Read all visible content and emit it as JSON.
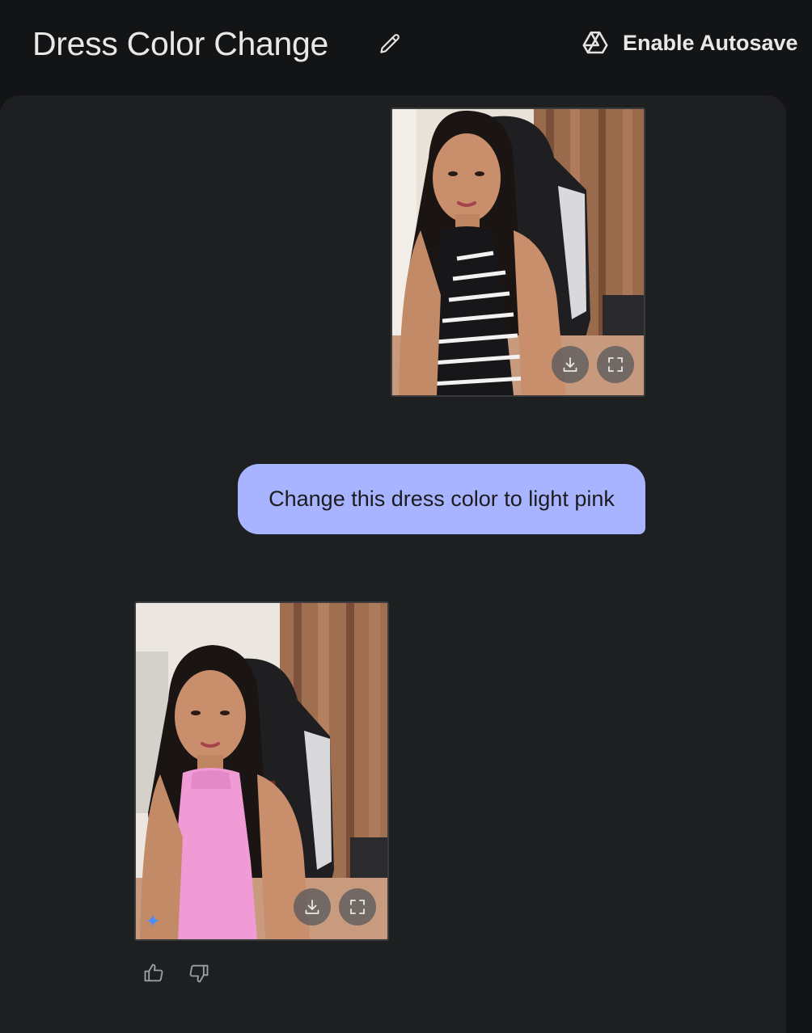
{
  "header": {
    "title": "Dress Color Change",
    "autosave_label": "Enable Autosave"
  },
  "conversation": {
    "user_message": "Change this dress color to light pink"
  },
  "icons": {
    "edit": "pencil-icon",
    "autosave": "google-drive-icon",
    "download": "download-icon",
    "fullscreen": "fullscreen-icon",
    "spark": "gemini-spark-icon",
    "like": "thumbs-up-icon",
    "dislike": "thumbs-down-icon"
  },
  "colors": {
    "background": "#131416",
    "panel": "#1e1f20",
    "bubble": "#a8b4ff",
    "text": "#e3e3e3"
  }
}
